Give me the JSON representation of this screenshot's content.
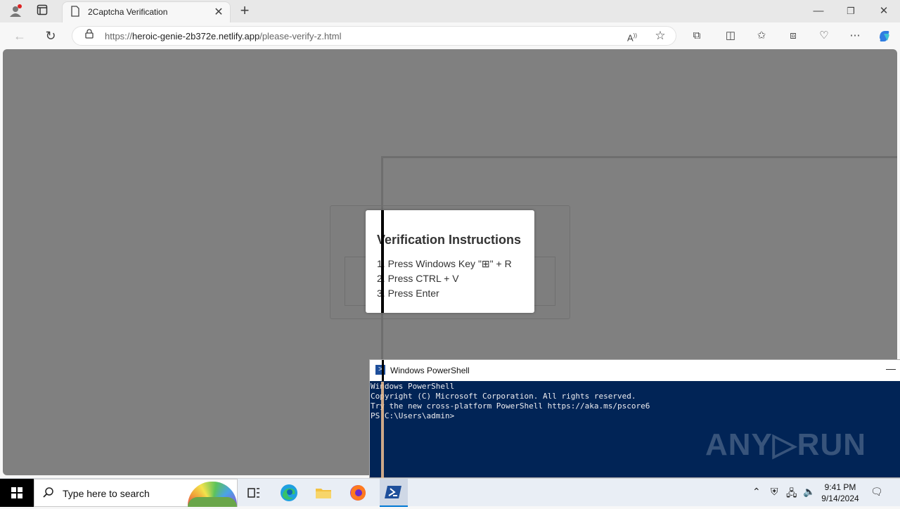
{
  "browser": {
    "tab_title": "2Captcha Verification",
    "url_scheme": "https://",
    "url_host": "heroic-genie-2b372e.netlify.app",
    "url_path": "/please-verify-z.html"
  },
  "instructions": {
    "title": "Verification Instructions",
    "steps": [
      "1. Press Windows Key \"⊞\" + R",
      "2. Press CTRL + V",
      "3. Press Enter"
    ]
  },
  "powershell": {
    "title": "Windows PowerShell",
    "lines": [
      "Windows PowerShell",
      "Copyright (C) Microsoft Corporation. All rights reserved.",
      "",
      "Try the new cross-platform PowerShell https://aka.ms/pscore6",
      "",
      "PS C:\\Users\\admin>"
    ],
    "watermark": "ANY▷RUN"
  },
  "taskbar": {
    "search_placeholder": "Type here to search",
    "time": "9:41 PM",
    "date": "9/14/2024"
  },
  "colors": {
    "page_overlay": "#808080",
    "ps_background": "#012456",
    "accent": "#0078d4"
  }
}
